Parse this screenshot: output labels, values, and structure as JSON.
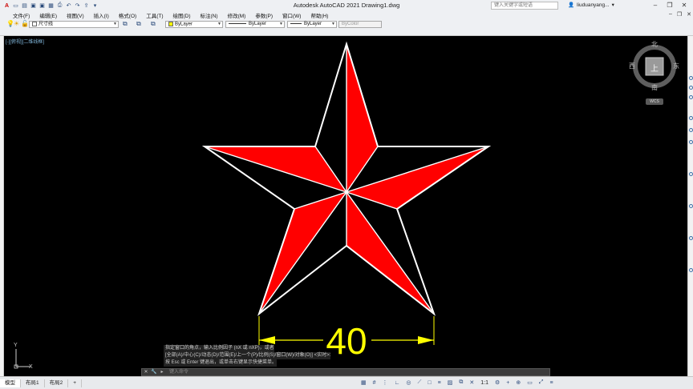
{
  "app": {
    "title": "Autodesk AutoCAD 2021    Drawing1.dwg",
    "search_placeholder": "键入关键字或短语",
    "user": "liuduanyang..."
  },
  "menu": [
    "文件(F)",
    "编辑(E)",
    "视图(V)",
    "插入(I)",
    "格式(O)",
    "工具(T)",
    "绘图(D)",
    "标注(N)",
    "修改(M)",
    "参数(P)",
    "窗口(W)",
    "帮助(H)"
  ],
  "toolbar": {
    "layer": "尺寸线",
    "color": "ByLayer",
    "linetype": "ByLayer",
    "lineweight": "ByLayer",
    "plotstyle": "ByColor"
  },
  "viewport": {
    "label": "[-][俯视][二维线框]"
  },
  "viewcube": {
    "north": "北",
    "south": "南",
    "east": "东",
    "west": "西",
    "top": "上",
    "wcs": "WCS"
  },
  "drawing": {
    "dimension_text": "40",
    "colors": {
      "fill": "#ff0000",
      "outline": "#ffffff",
      "dimension": "#ffff00"
    }
  },
  "ucs": {
    "y_label": "Y",
    "x_label": "X"
  },
  "command": {
    "history": [
      "指定窗口的角点，输入比例因子 (nX 或 nXP)，或者",
      "[全部(A)/中心(C)/动态(D)/范围(E)/上一个(P)/比例(S)/窗口(W)/对象(O)] <实时>:",
      "按 Esc 或 Enter 键退出，或单击右键显示快捷菜单。"
    ],
    "placeholder": "键入命令"
  },
  "status": {
    "tabs": [
      "模型",
      "布局1",
      "布局2",
      "+"
    ],
    "active_tab": 0,
    "scale": "1:1"
  }
}
